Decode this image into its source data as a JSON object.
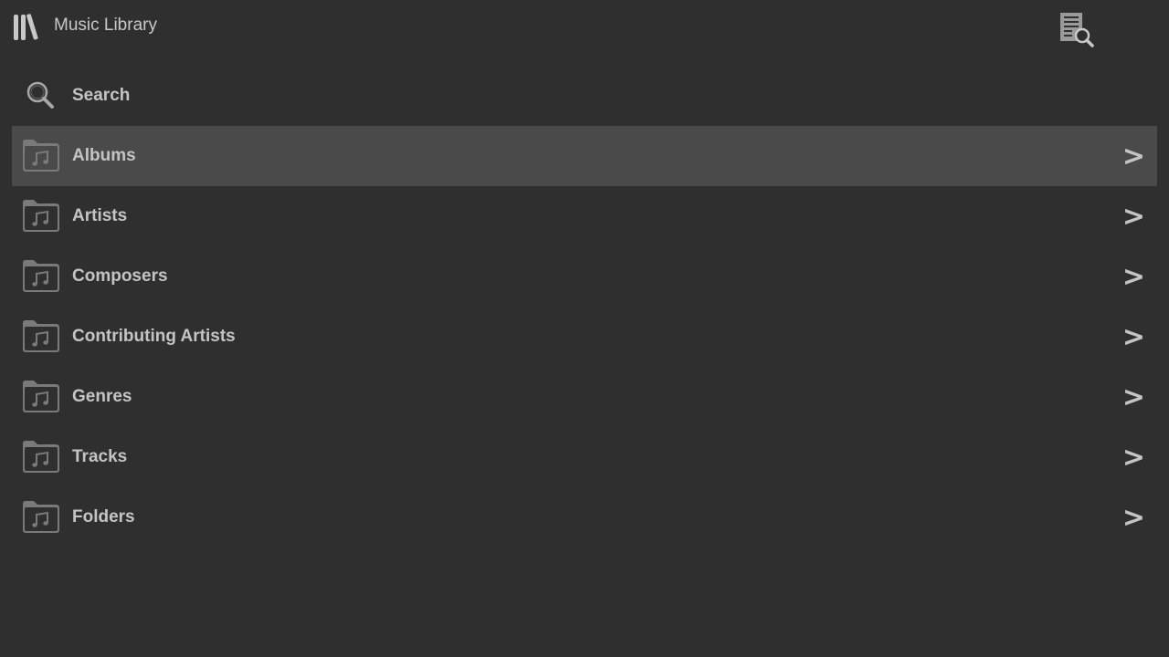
{
  "header": {
    "title": "Music Library",
    "library_icon": "library-books-icon",
    "browse_icon": "document-search-icon"
  },
  "search": {
    "label": "Search",
    "icon": "search-icon"
  },
  "items": [
    {
      "label": "Albums",
      "icon": "music-folder-icon",
      "chevron": ">",
      "selected": true
    },
    {
      "label": "Artists",
      "icon": "music-folder-icon",
      "chevron": ">",
      "selected": false
    },
    {
      "label": "Composers",
      "icon": "music-folder-icon",
      "chevron": ">",
      "selected": false
    },
    {
      "label": "Contributing Artists",
      "icon": "music-folder-icon",
      "chevron": ">",
      "selected": false
    },
    {
      "label": "Genres",
      "icon": "music-folder-icon",
      "chevron": ">",
      "selected": false
    },
    {
      "label": "Tracks",
      "icon": "music-folder-icon",
      "chevron": ">",
      "selected": false
    },
    {
      "label": "Folders",
      "icon": "music-folder-icon",
      "chevron": ">",
      "selected": false
    }
  ],
  "colors": {
    "background": "#2f2f2f",
    "selected_row": "#4a4a4a",
    "text": "#c4c4c4",
    "icon": "#7a7a7a"
  }
}
